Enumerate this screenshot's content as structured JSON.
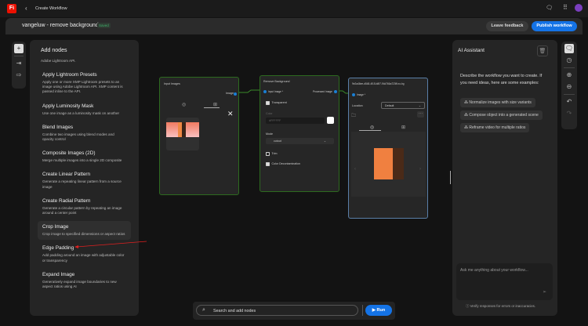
{
  "app": {
    "logo": "Fi",
    "back_label": "Create Workflow"
  },
  "header": {
    "title": "vangeluw - remove background",
    "status": "Saved",
    "feedback": "Leave feedback",
    "publish": "Publish workflow"
  },
  "add_nodes": {
    "title": "Add nodes",
    "partial_desc": "Adobe Lightroom API.",
    "items": [
      {
        "name": "Apply Lightroom Presets",
        "desc": "Apply one or more XMP Lightroom presets to an image using Adobe Lightroom API. XMP content is passed inline to the API."
      },
      {
        "name": "Apply Luminosity Mask",
        "desc": "Use one image as a luminosity mask on another"
      },
      {
        "name": "Blend Images",
        "desc": "Combine two images using blend modes and opacity control"
      },
      {
        "name": "Composite Images (2D)",
        "desc": "Merge multiple images into a single 2D composite"
      },
      {
        "name": "Create Linear Pattern",
        "desc": "Generate a repeating linear pattern from a source image"
      },
      {
        "name": "Create Radial Pattern",
        "desc": "Generate a circular pattern by repeating an image around a center point"
      },
      {
        "name": "Crop Image",
        "desc": "Crop image to specified dimensions or aspect ratios"
      },
      {
        "name": "Edge Padding",
        "desc": "Add padding around an image with adjustable color or transparency"
      },
      {
        "name": "Expand Image",
        "desc": "Generatively expand image boundaries to new aspect ratios using AI"
      }
    ]
  },
  "nodes": {
    "input": {
      "title": "Input Images",
      "port": "Image"
    },
    "remove_bg": {
      "title": "Remove Background",
      "in_port": "Input Image *",
      "out_port": "Processed Image",
      "transparent": "Transparent",
      "color_label": "Color",
      "color_value": "#FFFFFF",
      "mode_label": "Mode",
      "mode_value": "cutout",
      "trim": "Trim",
      "decontam": "Color Decontamination"
    },
    "output": {
      "title": "9e2a46ee-d548-4f15-b8f7-94d766a723ff-no-bg",
      "port": "Image *",
      "location_label": "Location",
      "location_value": "Default"
    }
  },
  "ai": {
    "title": "AI Assistant",
    "intro": "Describe the workflow you want to create. If you need ideas, here are some examples:",
    "suggestions": [
      "Normalize images with size variants",
      "Compose object into a generated scene",
      "Reframe video for multiple ratios"
    ],
    "placeholder": "Ask me anything about your workflow...",
    "disclaimer": "Verify responses for errors or inaccuracies."
  },
  "bottom": {
    "search_placeholder": "Search and add nodes",
    "run": "Run"
  },
  "colors": {
    "accent": "#1473e6",
    "node_border_green": "#2d6a1f",
    "node_border_blue": "#5a7fa8",
    "saved": "#3fae6a"
  }
}
